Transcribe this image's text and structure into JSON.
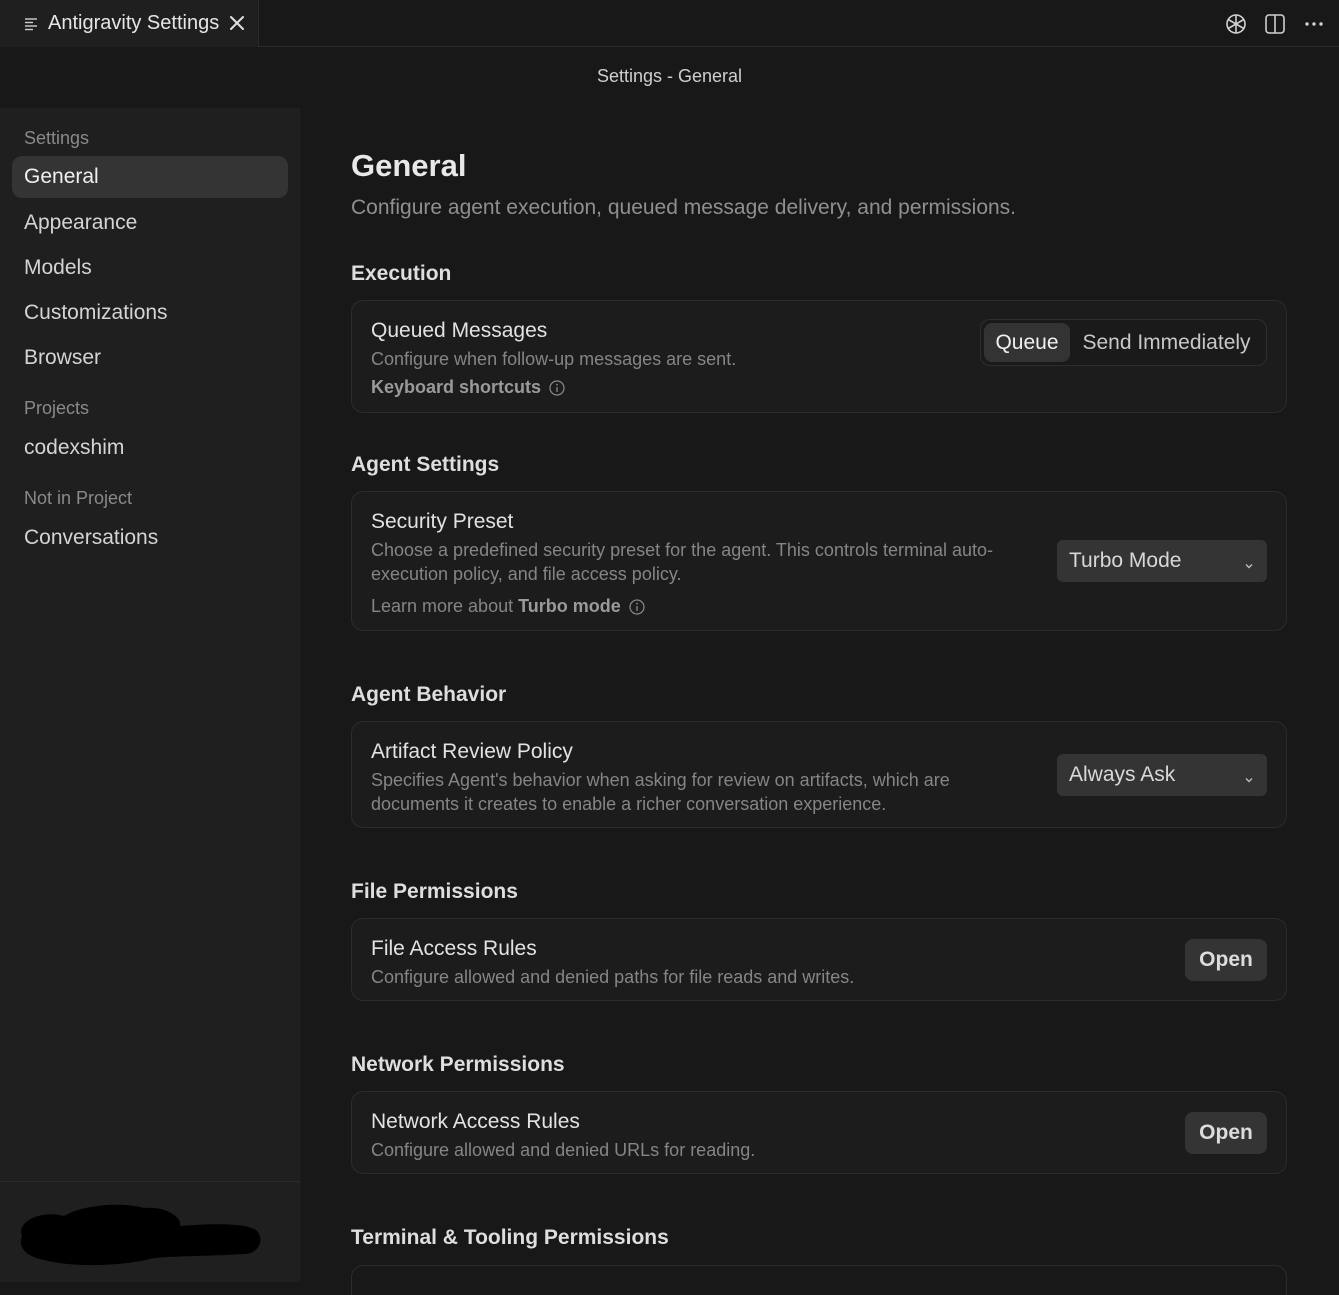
{
  "tab": {
    "title": "Antigravity Settings"
  },
  "header": {
    "page_title": "Settings - General"
  },
  "sidebar": {
    "groups": [
      {
        "label": "Settings"
      },
      {
        "label": "Projects"
      },
      {
        "label": "Not in Project"
      }
    ],
    "items": [
      {
        "label": "General",
        "active": true
      },
      {
        "label": "Appearance"
      },
      {
        "label": "Models"
      },
      {
        "label": "Customizations"
      },
      {
        "label": "Browser"
      },
      {
        "label": "codexshim"
      },
      {
        "label": "Conversations"
      }
    ]
  },
  "main": {
    "title": "General",
    "lead": "Configure agent execution, queued message delivery, and permissions.",
    "sections": {
      "execution": {
        "title": "Execution",
        "card": {
          "title": "Queued Messages",
          "desc": "Configure when follow-up messages are sent.",
          "link": "Keyboard shortcuts",
          "segments": [
            "Queue",
            "Send Immediately"
          ],
          "selected": "Queue"
        }
      },
      "agent_settings": {
        "title": "Agent Settings",
        "card": {
          "title": "Security Preset",
          "desc_line1": "Choose a predefined security preset for the agent. This controls terminal auto-",
          "desc_line2": "execution policy, and file access policy.",
          "link_prefix": "Learn more about",
          "link_bold": "Turbo mode",
          "select_value": "Turbo Mode"
        }
      },
      "agent_behavior": {
        "title": "Agent Behavior",
        "card": {
          "title": "Artifact Review Policy",
          "desc_line1": "Specifies Agent's behavior when asking for review on artifacts, which are",
          "desc_line2": "documents it creates to enable a richer conversation experience.",
          "select_value": "Always Ask"
        }
      },
      "file_permissions": {
        "title": "File Permissions",
        "card": {
          "title": "File Access Rules",
          "desc": "Configure allowed and denied paths for file reads and writes.",
          "button": "Open"
        }
      },
      "network_permissions": {
        "title": "Network Permissions",
        "card": {
          "title": "Network Access Rules",
          "desc": "Configure allowed and denied URLs for reading.",
          "button": "Open"
        }
      },
      "terminal_permissions": {
        "title": "Terminal & Tooling Permissions"
      }
    }
  },
  "icons": {
    "tab": "list-icon",
    "close": "close-icon",
    "ai": "openai-icon",
    "split": "split-editor-icon",
    "more": "more-icon",
    "info": "info-icon",
    "chevron": "chevron-down-icon"
  }
}
